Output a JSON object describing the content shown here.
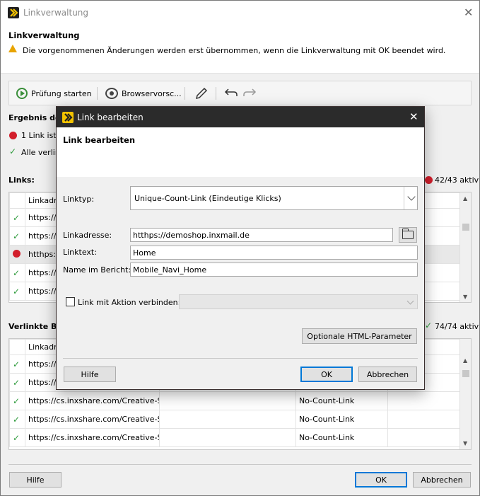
{
  "window": {
    "title": "Linkverwaltung",
    "header_title": "Linkverwaltung",
    "warning": "Die vorgenommenen Änderungen werden erst übernommen, wenn die Linkverwaltung mit OK beendet wird."
  },
  "toolbar": {
    "check_label": "Prüfung starten",
    "preview_label": "Browservorsc...",
    "edit_icon": "pencil-icon",
    "undo_icon": "undo-icon",
    "redo_icon": "redo-icon"
  },
  "result": {
    "title": "Ergebnis de",
    "error_text": "1 Link ist n",
    "ok_text": "Alle verlin"
  },
  "links": {
    "title": "Links:",
    "active": "42/43 aktiv",
    "header": "Linkadre",
    "rows": [
      {
        "status": "ok",
        "url": "https://c"
      },
      {
        "status": "ok",
        "url": "https://c"
      },
      {
        "status": "error",
        "url": "htthps://"
      },
      {
        "status": "ok",
        "url": "https://c"
      },
      {
        "status": "ok",
        "url": "https://c"
      }
    ]
  },
  "images": {
    "title": "Verlinkte Bi",
    "active": "74/74 aktiv",
    "header": "Linkadre",
    "rows": [
      {
        "status": "ok",
        "url": "https://c",
        "type": ""
      },
      {
        "status": "ok",
        "url": "https://c",
        "type": ""
      },
      {
        "status": "ok",
        "url": "https://cs.inxshare.com/Creative-S...",
        "type": "No-Count-Link"
      },
      {
        "status": "ok",
        "url": "https://cs.inxshare.com/Creative-S...",
        "type": "No-Count-Link"
      },
      {
        "status": "ok",
        "url": "https://cs.inxshare.com/Creative-S...",
        "type": "No-Count-Link"
      }
    ]
  },
  "footer": {
    "help": "Hilfe",
    "ok": "OK",
    "cancel": "Abbrechen"
  },
  "dialog": {
    "title": "Link bearbeiten",
    "header_title": "Link bearbeiten",
    "linktype_label": "Linktyp:",
    "linktype_value": "Unique-Count-Link (Eindeutige Klicks)",
    "url_label": "Linkadresse:",
    "url_value": "htthps://demoshop.inxmail.de",
    "text_label": "Linktext:",
    "text_value": "Home",
    "report_label": "Name im Bericht:",
    "report_value": "Mobile_Navi_Home",
    "action_label": "Link mit Aktion verbinden:",
    "action_value": "",
    "html_params": "Optionale HTML-Parameter",
    "help": "Hilfe",
    "ok": "OK",
    "cancel": "Abbrechen"
  },
  "colors": {
    "error": "#d21e2b",
    "ok": "#2e9b3c",
    "accent": "#0078d7",
    "dialog_titlebar": "#2b2b2b",
    "logo_yellow": "#f3c300"
  }
}
